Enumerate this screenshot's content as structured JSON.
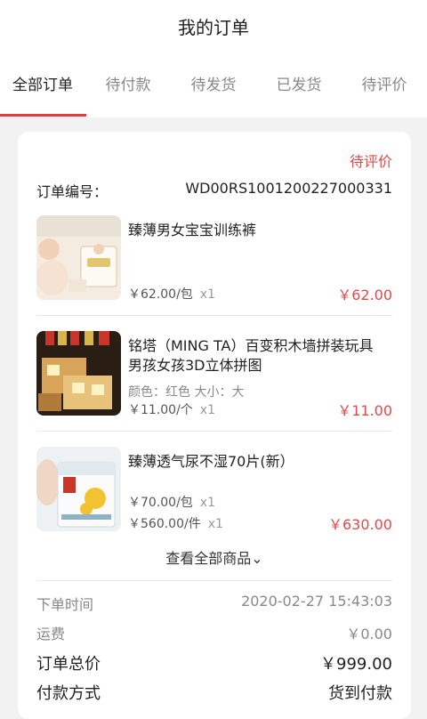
{
  "header": {
    "title": "我的订单"
  },
  "tabs": [
    {
      "label": "全部订单",
      "active": true
    },
    {
      "label": "待付款"
    },
    {
      "label": "待发货"
    },
    {
      "label": "已发货"
    },
    {
      "label": "待评价"
    }
  ],
  "order": {
    "status": "待评价",
    "number_label": "订单编号：",
    "number": "WD00RS1001200227000331",
    "items": [
      {
        "title": "臻薄男女宝宝训练裤",
        "prices": [
          {
            "price": "￥62.00/包",
            "qty": "x1"
          }
        ],
        "total": "￥62.00"
      },
      {
        "title": "铭塔（MING TA）百变积木墙拼装玩具 男孩女孩3D立体拼图",
        "spec": "颜色：红色 大小：大",
        "prices": [
          {
            "price": "￥11.00/个",
            "qty": "x1"
          }
        ],
        "total": "￥11.00"
      },
      {
        "title": "臻薄透气尿不湿70片(新）",
        "prices": [
          {
            "price": "￥70.00/包",
            "qty": "x1"
          },
          {
            "price": "￥560.00/件",
            "qty": "x1"
          }
        ],
        "total": "￥630.00"
      }
    ],
    "view_all": "查看全部商品⌄",
    "order_time_label": "下单时间",
    "order_time": "2020-02-27 15:43:03",
    "shipping_label": "运费",
    "shipping": "￥0.00",
    "total_label": "订单总价",
    "total": "￥999.00",
    "payment_label": "付款方式",
    "payment": "货到付款"
  }
}
